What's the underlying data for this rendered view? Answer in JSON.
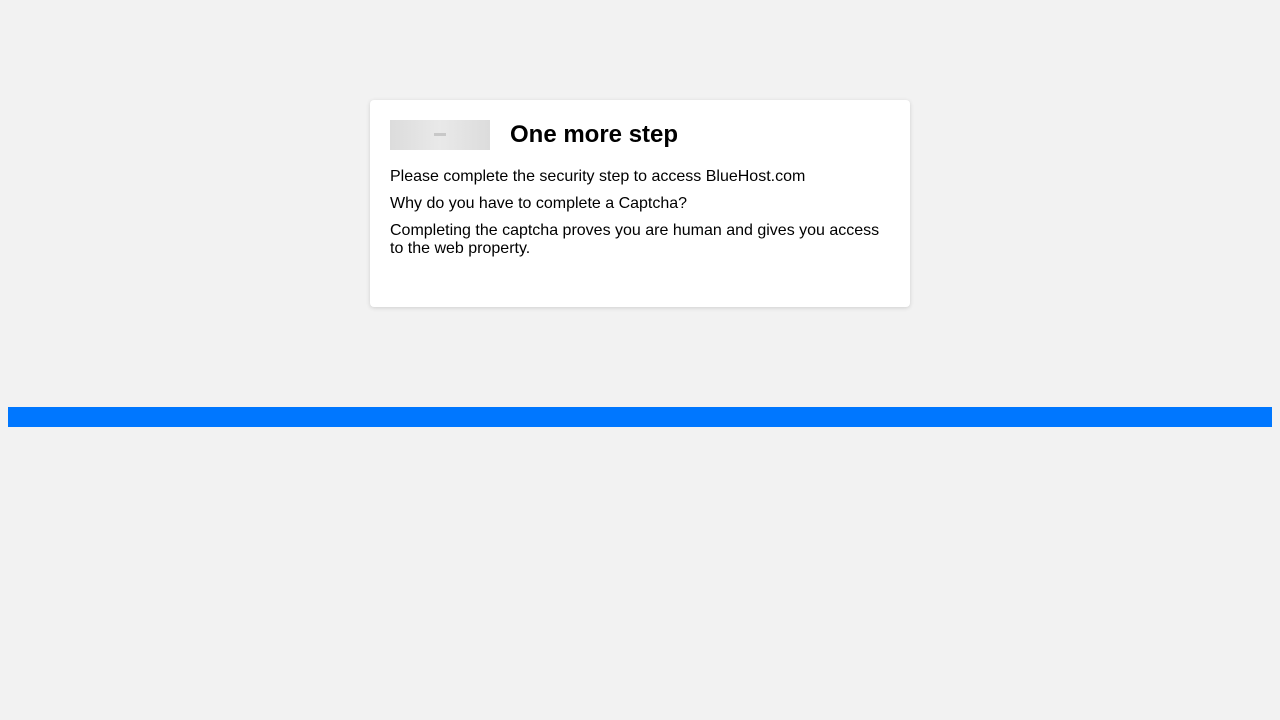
{
  "card": {
    "title": "One more step",
    "instruction": "Please complete the security step to access BlueHost.com",
    "question": "Why do you have to complete a Captcha?",
    "explanation": "Completing the captcha proves you are human and gives you access to the web property."
  },
  "colors": {
    "background": "#f2f2f2",
    "card_background": "#ffffff",
    "accent_bar": "#0077ff"
  }
}
